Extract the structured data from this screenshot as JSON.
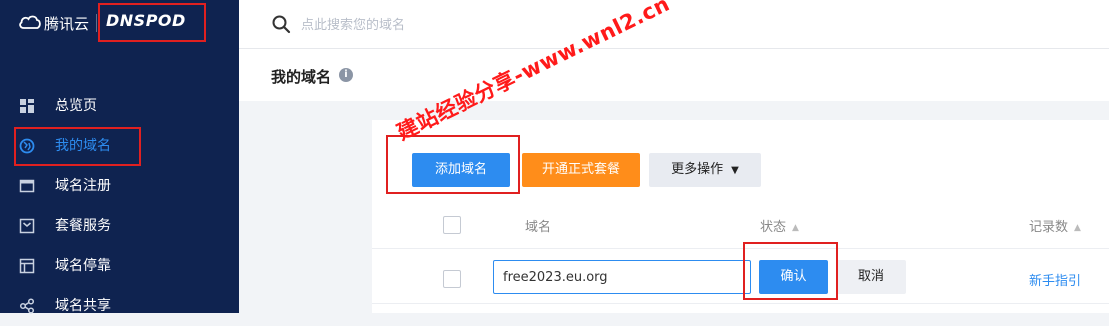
{
  "brand": {
    "tencent_cloud": "腾讯云",
    "dnspod": "DNSPOD"
  },
  "sidebar": {
    "items": [
      {
        "label": "总览页",
        "icon": "dashboard-icon",
        "active": false
      },
      {
        "label": "我的域名",
        "icon": "globe-icon",
        "active": true
      },
      {
        "label": "域名注册",
        "icon": "register-icon",
        "active": false
      },
      {
        "label": "套餐服务",
        "icon": "package-icon",
        "active": false
      },
      {
        "label": "域名停靠",
        "icon": "parking-icon",
        "active": false
      },
      {
        "label": "域名共享",
        "icon": "share-icon",
        "active": false
      }
    ]
  },
  "search": {
    "placeholder": "点此搜索您的域名"
  },
  "page": {
    "title": "我的域名"
  },
  "toolbar": {
    "add_domain": "添加域名",
    "open_plan": "开通正式套餐",
    "more_actions": "更多操作"
  },
  "table": {
    "headers": {
      "domain": "域名",
      "status": "状态",
      "records": "记录数"
    },
    "row": {
      "domain_value": "free2023.eu.org",
      "confirm": "确认",
      "cancel": "取消",
      "guide": "新手指引"
    }
  },
  "watermark": "建站经验分享-www.wnl2.cn",
  "colors": {
    "sidebar_bg": "#0f2350",
    "accent": "#2d8cf0",
    "orange": "#ff8d1a",
    "annotation": "#e02020"
  }
}
